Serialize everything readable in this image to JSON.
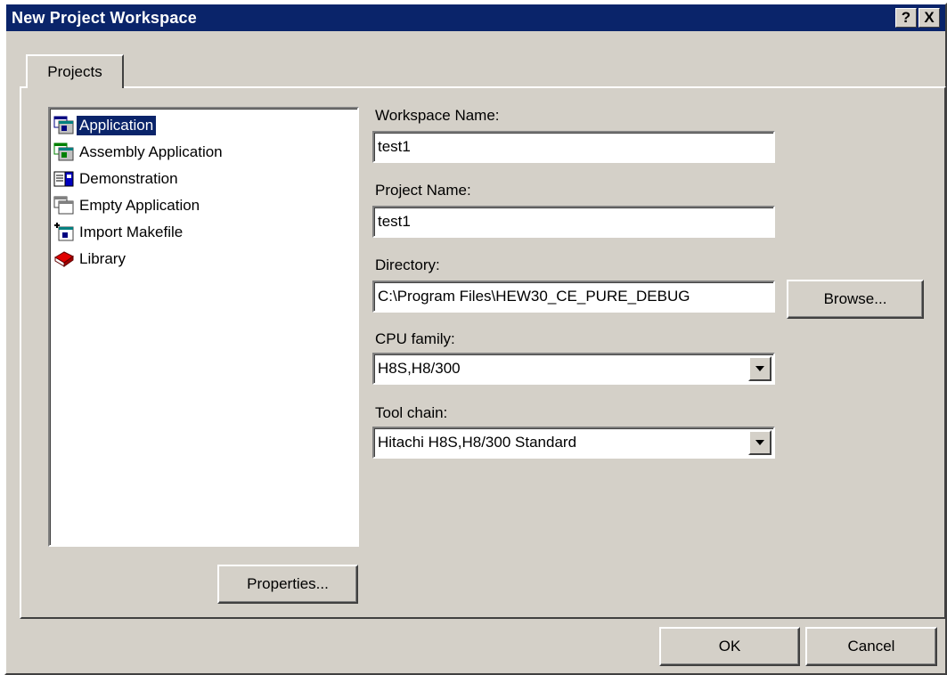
{
  "window": {
    "title": "New Project Workspace",
    "help_button": "?",
    "close_button": "X"
  },
  "tabs": [
    {
      "label": "Projects"
    }
  ],
  "project_types": {
    "items": [
      {
        "label": "Application",
        "icon": "application-icon",
        "selected": true
      },
      {
        "label": "Assembly Application",
        "icon": "assembly-application-icon",
        "selected": false
      },
      {
        "label": "Demonstration",
        "icon": "demonstration-icon",
        "selected": false
      },
      {
        "label": "Empty Application",
        "icon": "empty-application-icon",
        "selected": false
      },
      {
        "label": "Import Makefile",
        "icon": "import-makefile-icon",
        "selected": false
      },
      {
        "label": "Library",
        "icon": "library-book-icon",
        "selected": false
      }
    ]
  },
  "form": {
    "workspace_name_label": "Workspace Name:",
    "workspace_name_value": "test1",
    "project_name_label": "Project Name:",
    "project_name_value": "test1",
    "directory_label": "Directory:",
    "directory_value": "C:\\Program Files\\HEW30_CE_PURE_DEBUG",
    "browse_button": "Browse...",
    "cpu_family_label": "CPU family:",
    "cpu_family_value": "H8S,H8/300",
    "tool_chain_label": "Tool chain:",
    "tool_chain_value": "Hitachi H8S,H8/300 Standard"
  },
  "buttons": {
    "properties": "Properties...",
    "ok": "OK",
    "cancel": "Cancel"
  },
  "colors": {
    "face": "#d4d0c8",
    "titlebar": "#0a246a",
    "selection": "#0a246a"
  }
}
